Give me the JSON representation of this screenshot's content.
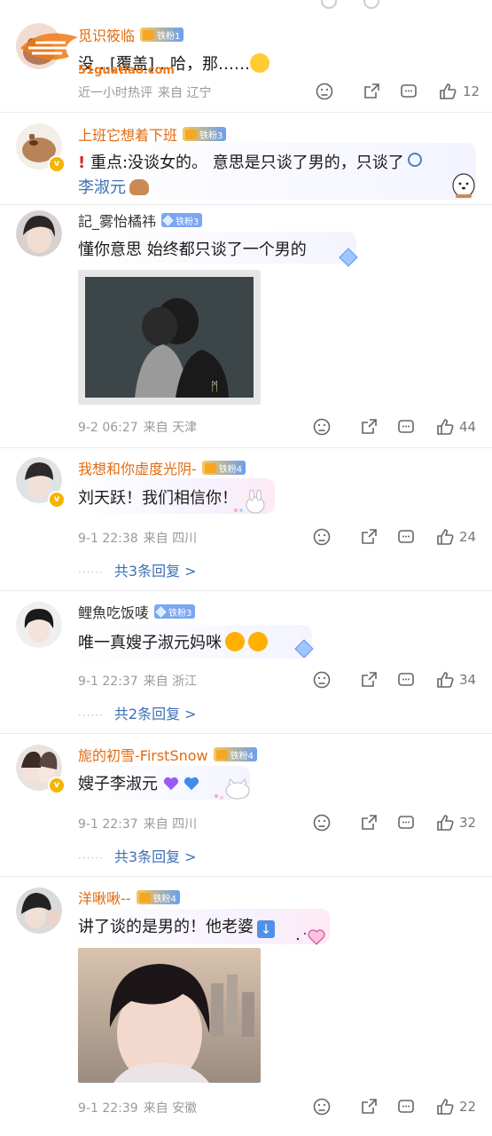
{
  "comments": [
    {
      "username": "觅识筱临",
      "fan_badge": "铁粉1",
      "text": "没…[覆盖]…哈，那……",
      "meta": [
        "近一小时热评",
        "来自 辽宁"
      ],
      "likes": "12"
    },
    {
      "username": "上班它想着下班",
      "fan_badge": "铁粉3",
      "text_line1_prefix": "重点:",
      "text_line1": "没谈女的。 意思是只谈了男的，只谈了",
      "text_line2": "李淑元"
    },
    {
      "username": "記_雾怡橘祎",
      "fan_badge": "铁粉3",
      "text": "懂你意思 始终都只谈了一个男的",
      "meta": [
        "9-2 06:27",
        "来自 天津"
      ],
      "likes": "44"
    },
    {
      "username": "我想和你虚度光阴-",
      "fan_badge": "铁粉4",
      "text": "刘天跃！我们相信你！",
      "meta": [
        "9-1 22:38",
        "来自 四川"
      ],
      "likes": "24",
      "replies": "共3条回复 >"
    },
    {
      "username": "鲤魚吃饭唛",
      "fan_badge": "铁粉3",
      "text": "唯一真嫂子淑元妈咪",
      "meta": [
        "9-1 22:37",
        "来自 浙江"
      ],
      "likes": "34",
      "replies": "共2条回复 >"
    },
    {
      "username": "旎的初雪-FirstSnow",
      "fan_badge": "铁粉4",
      "text": "嫂子李淑元",
      "meta": [
        "9-1 22:37",
        "来自 四川"
      ],
      "likes": "32",
      "replies": "共3条回复 >"
    },
    {
      "username": "洋啾啾--",
      "fan_badge": "铁粉4",
      "text": "讲了谈的是男的！他老婆",
      "meta": [
        "9-1 22:39",
        "来自 安徽"
      ],
      "likes": "22"
    }
  ],
  "watermark": {
    "brand": "51爆料",
    "url": "51guatiao.com"
  },
  "colors": {
    "username_orange": "#e06b12",
    "reply_link": "#3d6fb4",
    "meta_gray": "#999999"
  }
}
